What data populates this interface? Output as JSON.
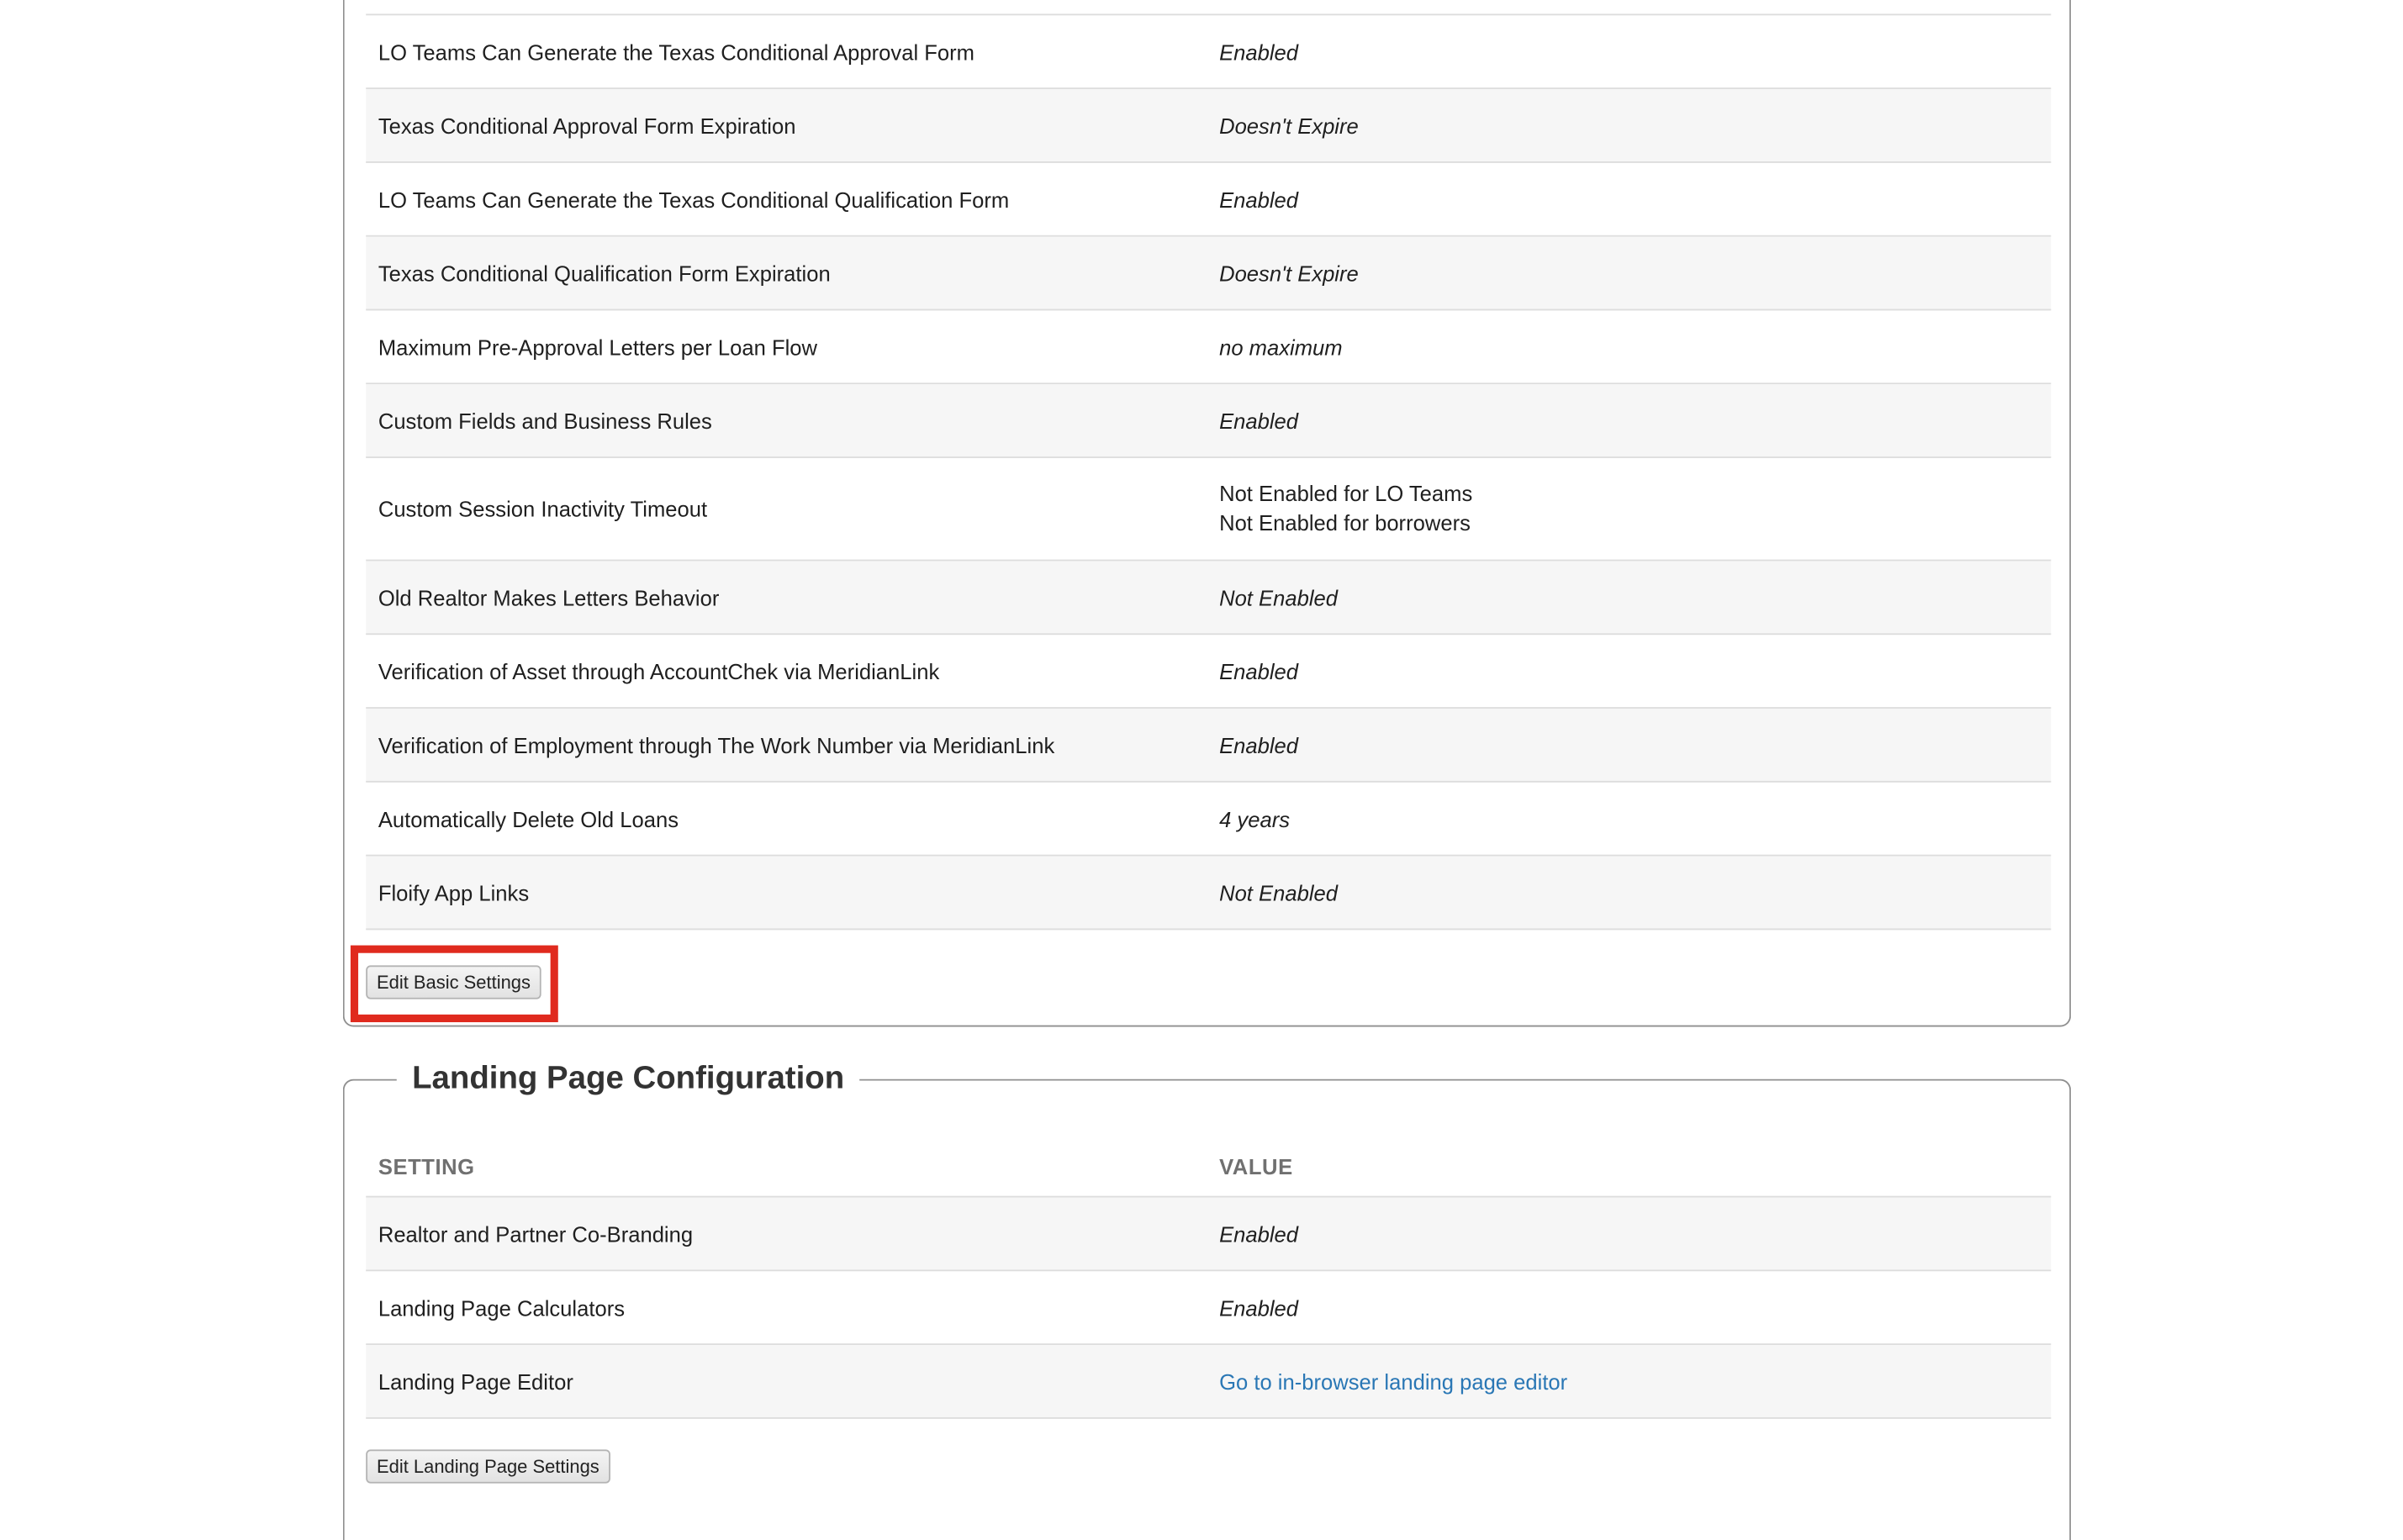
{
  "basic_settings": {
    "rows": [
      {
        "setting": "LO Teams Can Generate the Texas Conditional Approval Form",
        "value": "Enabled"
      },
      {
        "setting": "Texas Conditional Approval Form Expiration",
        "value": "Doesn't Expire"
      },
      {
        "setting": "LO Teams Can Generate the Texas Conditional Qualification Form",
        "value": "Enabled"
      },
      {
        "setting": "Texas Conditional Qualification Form Expiration",
        "value": "Doesn't Expire"
      },
      {
        "setting": "Maximum Pre-Approval Letters per Loan Flow",
        "value": "no maximum"
      },
      {
        "setting": "Custom Fields and Business Rules",
        "value": "Enabled"
      },
      {
        "setting": "Custom Session Inactivity Timeout",
        "value_line1": "Not Enabled for LO Teams",
        "value_line2": "Not Enabled for borrowers"
      },
      {
        "setting": "Old Realtor Makes Letters Behavior",
        "value": "Not Enabled"
      },
      {
        "setting": "Verification of Asset through AccountChek via MeridianLink",
        "value": "Enabled"
      },
      {
        "setting": "Verification of Employment through The Work Number via MeridianLink",
        "value": "Enabled"
      },
      {
        "setting": "Automatically Delete Old Loans",
        "value": "4 years"
      },
      {
        "setting": "Floify App Links",
        "value": "Not Enabled"
      }
    ],
    "edit_button_label": "Edit Basic Settings"
  },
  "landing_page": {
    "title": "Landing Page Configuration",
    "header_setting": "SETTING",
    "header_value": "VALUE",
    "rows": [
      {
        "setting": "Realtor and Partner Co-Branding",
        "value": "Enabled"
      },
      {
        "setting": "Landing Page Calculators",
        "value": "Enabled"
      },
      {
        "setting": "Landing Page Editor",
        "link_text": "Go to in-browser landing page editor"
      }
    ],
    "edit_button_label": "Edit Landing Page Settings"
  },
  "colors": {
    "highlight": "#e02a1e",
    "link": "#2a77b5",
    "row_stripe": "#f6f6f6"
  }
}
